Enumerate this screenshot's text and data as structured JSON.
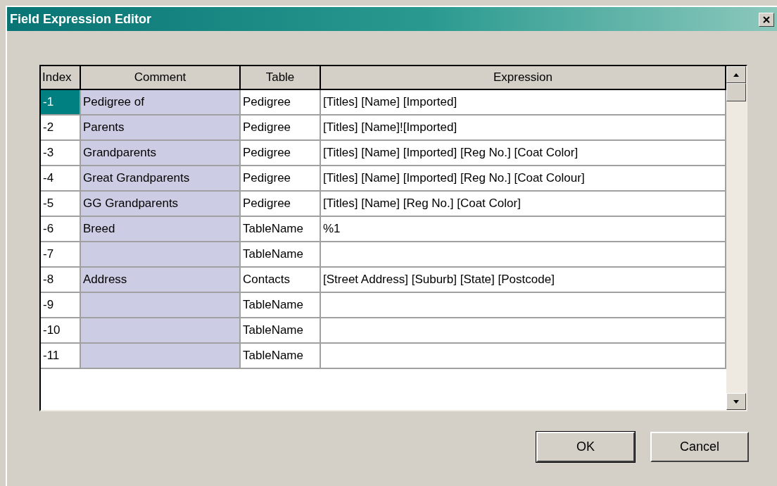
{
  "window": {
    "title": "Field Expression Editor"
  },
  "table": {
    "columns": [
      "Index",
      "Comment",
      "Table",
      "Expression"
    ],
    "rows": [
      {
        "index": "-1",
        "comment": "Pedigree of",
        "table": "Pedigree",
        "expression": "[Titles] [Name] [Imported]",
        "selected": true
      },
      {
        "index": "-2",
        "comment": "Parents",
        "table": "Pedigree",
        "expression": "[Titles] [Name]![Imported]",
        "selected": false
      },
      {
        "index": "-3",
        "comment": "Grandparents",
        "table": "Pedigree",
        "expression": "[Titles] [Name] [Imported] [Reg No.] [Coat Color]",
        "selected": false
      },
      {
        "index": "-4",
        "comment": "Great Grandparents",
        "table": "Pedigree",
        "expression": "[Titles] [Name] [Imported] [Reg No.] [Coat Colour]",
        "selected": false
      },
      {
        "index": "-5",
        "comment": "GG Grandparents",
        "table": "Pedigree",
        "expression": "[Titles] [Name] [Reg No.] [Coat Color]",
        "selected": false
      },
      {
        "index": "-6",
        "comment": "Breed",
        "table": "TableName",
        "expression": "%1",
        "selected": false
      },
      {
        "index": "-7",
        "comment": "",
        "table": "TableName",
        "expression": "",
        "selected": false
      },
      {
        "index": "-8",
        "comment": "Address",
        "table": "Contacts",
        "expression": "[Street Address] [Suburb] [State] [Postcode]",
        "selected": false
      },
      {
        "index": "-9",
        "comment": "",
        "table": "TableName",
        "expression": "",
        "selected": false
      },
      {
        "index": "-10",
        "comment": "",
        "table": "TableName",
        "expression": "",
        "selected": false
      },
      {
        "index": "-11",
        "comment": "",
        "table": "TableName",
        "expression": "",
        "selected": false
      }
    ]
  },
  "buttons": [
    "OK",
    "Cancel"
  ]
}
